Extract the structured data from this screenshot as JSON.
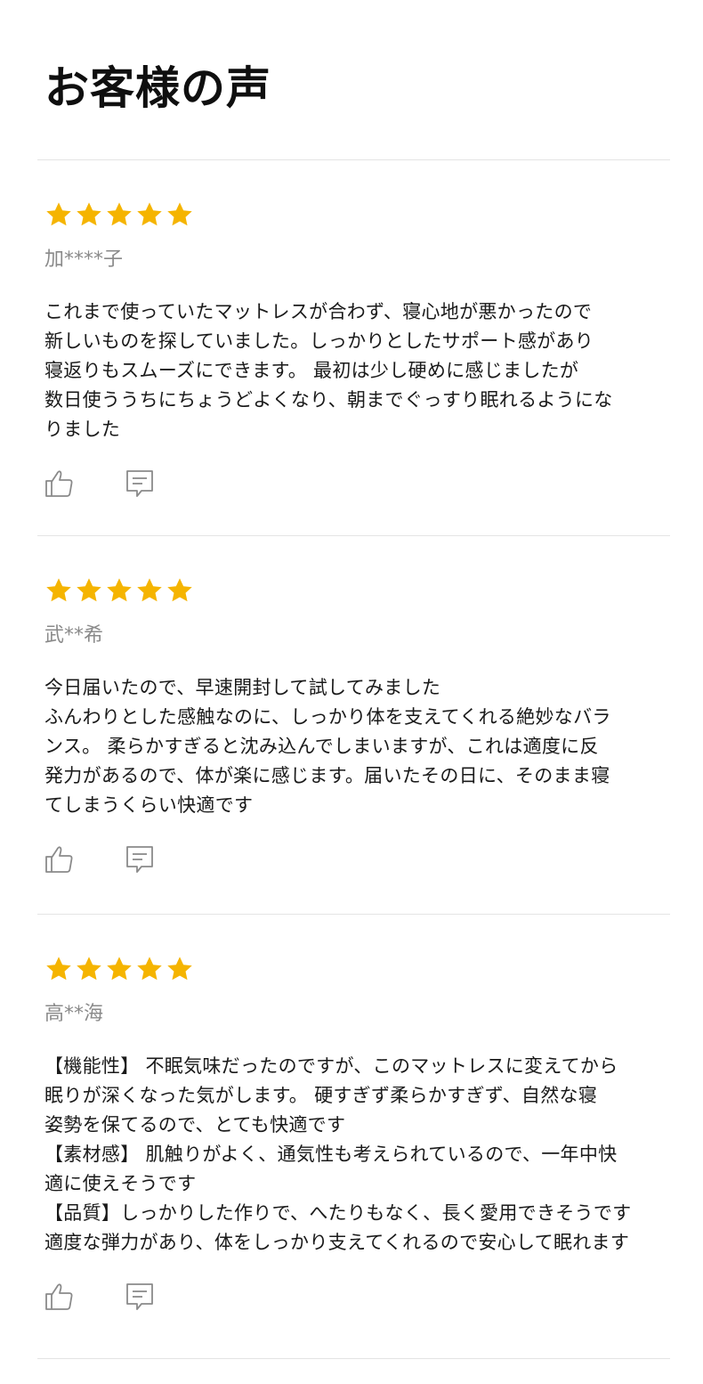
{
  "page": {
    "title": "お客様の声"
  },
  "colors": {
    "star": "#f5b400",
    "icon": "#8a8a8a",
    "divider": "#e4e4e4"
  },
  "reviews": [
    {
      "rating": 5,
      "author": "加****子",
      "body": "これまで使っていたマットレスが合わず、寝心地が悪かったので\n新しいものを探していました。しっかりとしたサポート感があり\n寝返りもスムーズにできます。 最初は少し硬めに感じましたが\n数日使ううちにちょうどよくなり、朝までぐっすり眠れるようにな\nりました",
      "like_icon": "thumbs-up-icon",
      "comment_icon": "comment-icon"
    },
    {
      "rating": 5,
      "author": "武**希",
      "body": "今日届いたので、早速開封して試してみました\nふんわりとした感触なのに、しっかり体を支えてくれる絶妙なバラ\nンス。 柔らかすぎると沈み込んでしまいますが、これは適度に反\n発力があるので、体が楽に感じます。届いたその日に、そのまま寝\nてしまうくらい快適です",
      "like_icon": "thumbs-up-icon",
      "comment_icon": "comment-icon"
    },
    {
      "rating": 5,
      "author": "高**海",
      "body": "【機能性】 不眠気味だったのですが、このマットレスに変えてから\n眠りが深くなった気がします。 硬すぎず柔らかすぎず、自然な寝\n姿勢を保てるので、とても快適です\n【素材感】 肌触りがよく、通気性も考えられているので、一年中快\n適に使えそうです\n【品質】しっかりした作りで、へたりもなく、長く愛用できそうです\n適度な弾力があり、体をしっかり支えてくれるので安心して眠れます",
      "like_icon": "thumbs-up-icon",
      "comment_icon": "comment-icon"
    }
  ]
}
